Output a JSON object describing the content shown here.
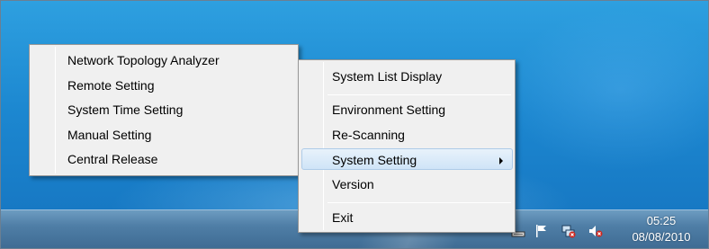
{
  "submenu": {
    "items": [
      {
        "label": "Network Topology Analyzer"
      },
      {
        "label": "Remote Setting"
      },
      {
        "label": "System Time Setting"
      },
      {
        "label": "Manual Setting"
      },
      {
        "label": "Central Release"
      }
    ]
  },
  "context_menu": {
    "items": [
      {
        "label": "System List Display"
      },
      {
        "label": "Environment Setting"
      },
      {
        "label": "Re-Scanning"
      },
      {
        "label": "System Setting",
        "has_submenu": true,
        "highlighted": true
      },
      {
        "label": "Version"
      },
      {
        "label": "Exit"
      }
    ]
  },
  "taskbar": {
    "tray_icons": [
      "network-monitor-icon",
      "action-center-flag-icon",
      "network-error-icon",
      "volume-muted-icon"
    ],
    "clock": {
      "time": "05:25",
      "date": "08/08/2010"
    }
  },
  "colors": {
    "desktop": "#1c87d0",
    "menu_background": "#f0f0f0",
    "highlight": "#cfe4f7",
    "taskbar": "#4f7ea6"
  }
}
